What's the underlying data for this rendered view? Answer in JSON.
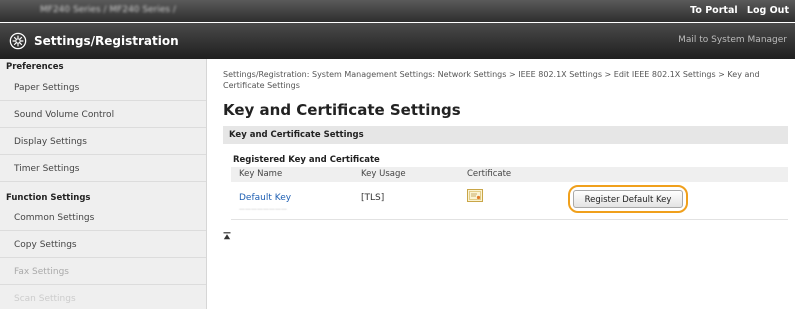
{
  "topbar": {
    "device_name": "MF240 Series / MF240 Series /",
    "portal_link": "To Portal",
    "logout_link": "Log Out"
  },
  "header": {
    "title": "Settings/Registration",
    "mail_link": "Mail to System Manager"
  },
  "sidebar": {
    "preferences_label": "Preferences",
    "function_label": "Function Settings",
    "items": [
      {
        "label": "Paper Settings"
      },
      {
        "label": "Sound Volume Control"
      },
      {
        "label": "Display Settings"
      },
      {
        "label": "Timer Settings"
      },
      {
        "label": "Common Settings"
      },
      {
        "label": "Copy Settings"
      },
      {
        "label": "Fax Settings"
      },
      {
        "label": "Scan Settings"
      }
    ]
  },
  "main": {
    "breadcrumb": "Settings/Registration: System Management Settings: Network Settings > IEEE 802.1X Settings > Edit IEEE 802.1X Settings > Key and Certificate Settings",
    "title": "Key and Certificate Settings",
    "section_header": "Key and Certificate Settings",
    "subheader": "Registered Key and Certificate",
    "table": {
      "columns": [
        "Key Name",
        "Key Usage",
        "Certificate"
      ],
      "rows": [
        {
          "key_name": "Default Key",
          "key_usage": "[TLS]"
        }
      ]
    },
    "register_button": "Register Default Key"
  },
  "colors": {
    "highlight": "#f0a01c",
    "link": "#1e5fb3"
  }
}
